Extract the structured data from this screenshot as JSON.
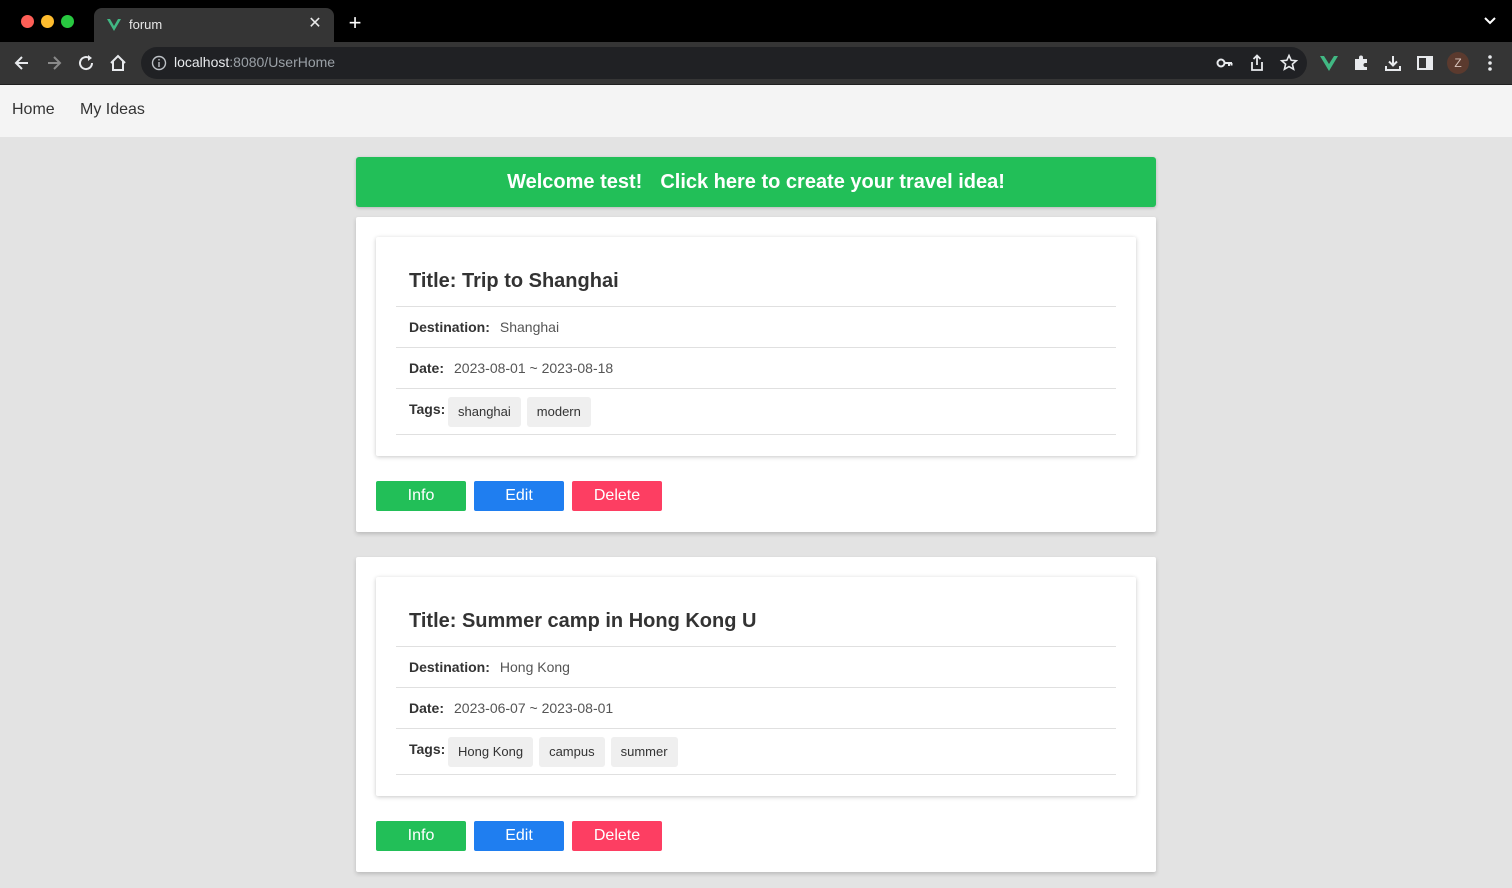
{
  "browser": {
    "tab_title": "forum",
    "url_host": "localhost",
    "url_path": ":8080/UserHome",
    "avatar_letter": "Z",
    "accent": "#41b883"
  },
  "nav": {
    "home_label": "Home",
    "my_ideas_label": "My Ideas"
  },
  "banner": {
    "welcome": "Welcome test!",
    "cta": "Click here to create your travel idea!",
    "color": "#22bf58"
  },
  "ideas": [
    {
      "title": "Title: Trip to Shanghai",
      "destination_label": "Destination:",
      "destination": "Shanghai",
      "date_label": "Date:",
      "date": "2023-08-01 ~ 2023-08-18",
      "tags_label": "Tags:",
      "tags": [
        "shanghai",
        "modern"
      ]
    },
    {
      "title": "Title: Summer camp in Hong Kong U",
      "destination_label": "Destination:",
      "destination": "Hong Kong",
      "date_label": "Date:",
      "date": "2023-06-07 ~ 2023-08-01",
      "tags_label": "Tags:",
      "tags": [
        "Hong Kong",
        "campus",
        "summer"
      ]
    }
  ],
  "buttons": {
    "info": "Info",
    "edit": "Edit",
    "delete": "Delete",
    "info_color": "#22bf58",
    "edit_color": "#1f7ef0",
    "delete_color": "#fd3e62"
  }
}
